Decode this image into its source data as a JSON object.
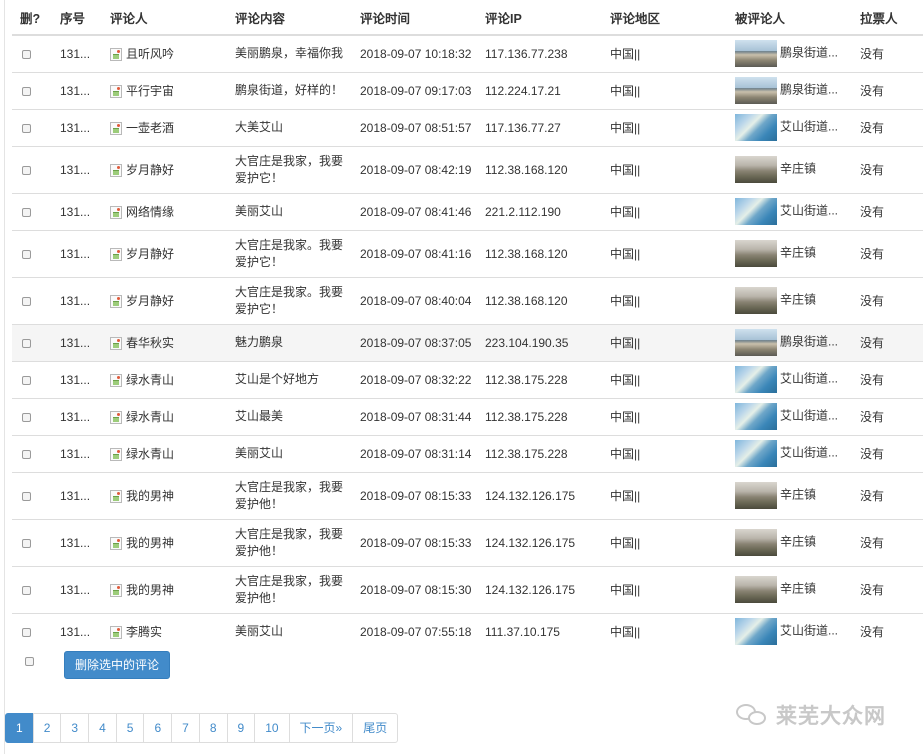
{
  "table": {
    "headers": [
      "删?",
      "序号",
      "评论人",
      "评论内容",
      "评论时间",
      "评论IP",
      "评论地区",
      "被评论人",
      "拉票人"
    ],
    "rows": [
      {
        "id": "131...",
        "commenter": "且听风吟",
        "content": "美丽鹏泉，幸福你我",
        "time": "2018-09-07 10:18:32",
        "ip": "117.136.77.238",
        "region": "中国||",
        "target": "鹏泉街道...",
        "target_thumb": "town",
        "voter": "没有"
      },
      {
        "id": "131...",
        "commenter": "平行宇宙",
        "content": "鹏泉街道，好样的！",
        "time": "2018-09-07 09:17:03",
        "ip": "112.224.17.21",
        "region": "中国||",
        "target": "鹏泉街道...",
        "target_thumb": "town",
        "voter": "没有"
      },
      {
        "id": "131...",
        "commenter": "一壶老酒",
        "content": "大美艾山",
        "time": "2018-09-07 08:51:57",
        "ip": "117.136.77.27",
        "region": "中国||",
        "target": "艾山街道...",
        "target_thumb": "aerial",
        "voter": "没有"
      },
      {
        "id": "131...",
        "commenter": "岁月静好",
        "content": "大官庄是我家，我要爱护它！",
        "time": "2018-09-07 08:42:19",
        "ip": "112.38.168.120",
        "region": "中国||",
        "target": "辛庄镇",
        "target_thumb": "village",
        "voter": "没有"
      },
      {
        "id": "131...",
        "commenter": "网络情缘",
        "content": "美丽艾山",
        "time": "2018-09-07 08:41:46",
        "ip": "221.2.112.190",
        "region": "中国||",
        "target": "艾山街道...",
        "target_thumb": "aerial",
        "voter": "没有"
      },
      {
        "id": "131...",
        "commenter": "岁月静好",
        "content": "大官庄是我家。我要爱护它！",
        "time": "2018-09-07 08:41:16",
        "ip": "112.38.168.120",
        "region": "中国||",
        "target": "辛庄镇",
        "target_thumb": "village",
        "voter": "没有"
      },
      {
        "id": "131...",
        "commenter": "岁月静好",
        "content": "大官庄是我家。我要爱护它！",
        "time": "2018-09-07 08:40:04",
        "ip": "112.38.168.120",
        "region": "中国||",
        "target": "辛庄镇",
        "target_thumb": "village",
        "voter": "没有"
      },
      {
        "id": "131...",
        "commenter": "春华秋实",
        "content": "魅力鹏泉",
        "time": "2018-09-07 08:37:05",
        "ip": "223.104.190.35",
        "region": "中国||",
        "target": "鹏泉街道...",
        "target_thumb": "town",
        "voter": "没有"
      },
      {
        "id": "131...",
        "commenter": "绿水青山",
        "content": "艾山是个好地方",
        "time": "2018-09-07 08:32:22",
        "ip": "112.38.175.228",
        "region": "中国||",
        "target": "艾山街道...",
        "target_thumb": "aerial",
        "voter": "没有"
      },
      {
        "id": "131...",
        "commenter": "绿水青山",
        "content": "艾山最美",
        "time": "2018-09-07 08:31:44",
        "ip": "112.38.175.228",
        "region": "中国||",
        "target": "艾山街道...",
        "target_thumb": "aerial",
        "voter": "没有"
      },
      {
        "id": "131...",
        "commenter": "绿水青山",
        "content": "美丽艾山",
        "time": "2018-09-07 08:31:14",
        "ip": "112.38.175.228",
        "region": "中国||",
        "target": "艾山街道...",
        "target_thumb": "aerial",
        "voter": "没有"
      },
      {
        "id": "131...",
        "commenter": "我的男神",
        "content": "大官庄是我家，我要爱护他！",
        "time": "2018-09-07 08:15:33",
        "ip": "124.132.126.175",
        "region": "中国||",
        "target": "辛庄镇",
        "target_thumb": "village",
        "voter": "没有"
      },
      {
        "id": "131...",
        "commenter": "我的男神",
        "content": "大官庄是我家，我要爱护他！",
        "time": "2018-09-07 08:15:33",
        "ip": "124.132.126.175",
        "region": "中国||",
        "target": "辛庄镇",
        "target_thumb": "village",
        "voter": "没有"
      },
      {
        "id": "131...",
        "commenter": "我的男神",
        "content": "大官庄是我家，我要爱护他！",
        "time": "2018-09-07 08:15:30",
        "ip": "124.132.126.175",
        "region": "中国||",
        "target": "辛庄镇",
        "target_thumb": "village",
        "voter": "没有"
      },
      {
        "id": "131...",
        "commenter": "李腾实",
        "content": "美丽艾山",
        "time": "2018-09-07 07:55:18",
        "ip": "111.37.10.175",
        "region": "中国||",
        "target": "艾山街道...",
        "target_thumb": "aerial",
        "voter": "没有"
      }
    ],
    "highlighted_row": 7
  },
  "actions": {
    "delete_selected_label": "删除选中的评论"
  },
  "pagination": {
    "pages": [
      "1",
      "2",
      "3",
      "4",
      "5",
      "6",
      "7",
      "8",
      "9",
      "10"
    ],
    "active_page": "1",
    "next_label": "下一页»",
    "last_label": "尾页"
  },
  "watermark": {
    "text": "莱芜大众网"
  },
  "colors": {
    "primary": "#428bca",
    "border": "#dddddd",
    "row_highlight": "#f5f5f5"
  }
}
